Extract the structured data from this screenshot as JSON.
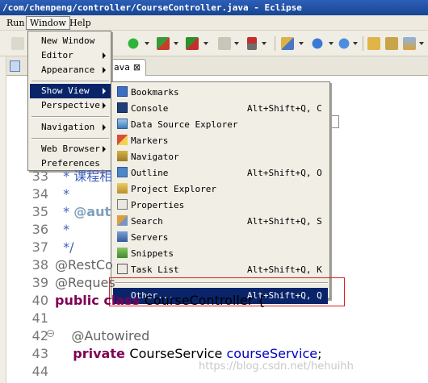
{
  "window": {
    "title": "/com/chenpeng/controller/CourseController.java - Eclipse"
  },
  "menubar": {
    "items": [
      "Run",
      "Window",
      "Help"
    ]
  },
  "editor": {
    "tab_label": "ava",
    "tab_close": "⊠",
    "lines": [
      {
        "num": "33",
        "parts": [
          {
            "cls": "c-comment",
            "text": "  * 课程相"
          }
        ]
      },
      {
        "num": "34",
        "parts": [
          {
            "cls": "c-comment",
            "text": "  *"
          }
        ]
      },
      {
        "num": "35",
        "parts": [
          {
            "cls": "c-comment",
            "text": "  * "
          },
          {
            "cls": "c-tag",
            "text": "@aut"
          }
        ]
      },
      {
        "num": "36",
        "parts": [
          {
            "cls": "c-comment",
            "text": "  *"
          }
        ]
      },
      {
        "num": "37",
        "parts": [
          {
            "cls": "c-comment",
            "text": "  */"
          }
        ]
      },
      {
        "num": "38",
        "parts": [
          {
            "cls": "c-ann",
            "text": "@RestCo"
          }
        ]
      },
      {
        "num": "39",
        "parts": [
          {
            "cls": "c-ann",
            "text": "@Reques"
          }
        ]
      },
      {
        "num": "40",
        "parts": [
          {
            "cls": "c-kw",
            "text": "public "
          },
          {
            "cls": "c-kw",
            "text": "class "
          },
          {
            "cls": "c-plain",
            "text": "CourseController {"
          }
        ]
      },
      {
        "num": "41",
        "parts": []
      },
      {
        "num": "42",
        "parts": [
          {
            "cls": "c-ann",
            "text": "    @Autowired"
          }
        ]
      },
      {
        "num": "43",
        "parts": [
          {
            "cls": "c-kw",
            "text": "    private "
          },
          {
            "cls": "c-plain",
            "text": "CourseService "
          },
          {
            "cls": "c-field",
            "text": "courseService"
          },
          {
            "cls": "c-plain",
            "text": ";"
          }
        ]
      },
      {
        "num": "44",
        "parts": []
      }
    ]
  },
  "window_menu": {
    "items": [
      {
        "label": "New Window",
        "submenu": false
      },
      {
        "label": "Editor",
        "submenu": true
      },
      {
        "label": "Appearance",
        "submenu": true
      },
      {
        "label": "Show View",
        "submenu": true
      },
      {
        "label": "Perspective",
        "submenu": true
      },
      {
        "label": "Navigation",
        "submenu": true
      },
      {
        "label": "Web Browser",
        "submenu": true
      },
      {
        "label": "Preferences",
        "submenu": false
      }
    ]
  },
  "show_view_menu": {
    "items": [
      {
        "label": "Bookmarks",
        "shortcut": "",
        "icon": "bookmarks-icon"
      },
      {
        "label": "Console",
        "shortcut": "Alt+Shift+Q, C",
        "icon": "console-icon"
      },
      {
        "label": "Data Source Explorer",
        "shortcut": "",
        "icon": "data-source-icon"
      },
      {
        "label": "Markers",
        "shortcut": "",
        "icon": "markers-icon"
      },
      {
        "label": "Navigator",
        "shortcut": "",
        "icon": "navigator-icon"
      },
      {
        "label": "Outline",
        "shortcut": "Alt+Shift+Q, O",
        "icon": "outline-icon"
      },
      {
        "label": "Project Explorer",
        "shortcut": "",
        "icon": "project-explorer-icon"
      },
      {
        "label": "Properties",
        "shortcut": "",
        "icon": "properties-icon"
      },
      {
        "label": "Search",
        "shortcut": "Alt+Shift+Q, S",
        "icon": "search-icon"
      },
      {
        "label": "Servers",
        "shortcut": "",
        "icon": "servers-icon"
      },
      {
        "label": "Snippets",
        "shortcut": "",
        "icon": "snippets-icon"
      },
      {
        "label": "Task List",
        "shortcut": "Alt+Shift+Q, K",
        "icon": "task-list-icon"
      },
      {
        "label": "Other...",
        "shortcut": "Alt+Shift+Q, Q",
        "icon": ""
      }
    ]
  },
  "watermark": "https://blog.csdn.net/hehuihh",
  "colors": {
    "selection": "#0a246a",
    "highlight_box": "#e02020",
    "keyword": "#7f0055",
    "comment": "#3f5fbf",
    "field": "#0000c0"
  }
}
